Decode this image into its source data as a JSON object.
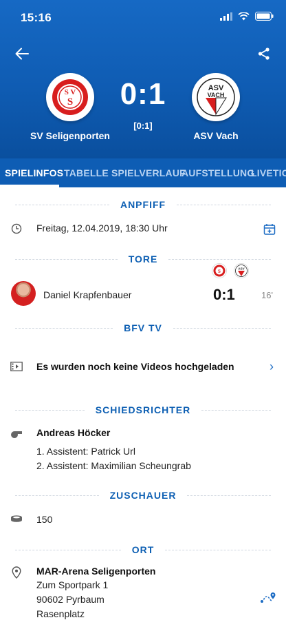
{
  "status_bar": {
    "time": "15:16"
  },
  "match": {
    "home_team": "SV Seligenporten",
    "away_team": "ASV Vach",
    "score": "0:1",
    "halftime": "[0:1]",
    "home_logo_text": "SVS",
    "away_logo_text": "ASV VACH"
  },
  "tabs": [
    {
      "label": "SPIELINFOS",
      "active": true
    },
    {
      "label": "TABELLE",
      "active": false
    },
    {
      "label": "SPIELVERLAUF",
      "active": false
    },
    {
      "label": "AUFSTELLUNG",
      "active": false
    },
    {
      "label": "LIVETICK",
      "active": false
    }
  ],
  "sections": {
    "anpfiff": {
      "title": "ANPFIFF",
      "datetime": "Freitag, 12.04.2019, 18:30 Uhr"
    },
    "tore": {
      "title": "TORE",
      "scorer": "Daniel Krapfenbauer",
      "score": "0:1",
      "minute": "16'"
    },
    "bfv_tv": {
      "title": "BFV TV",
      "message": "Es wurden noch keine Videos hochgeladen"
    },
    "schiedsrichter": {
      "title": "SCHIEDSRICHTER",
      "referee": "Andreas Höcker",
      "assistant1": "1. Assistent: Patrick Url",
      "assistant2": "2. Assistent: Maximilian Scheungrab"
    },
    "zuschauer": {
      "title": "ZUSCHAUER",
      "count": "150"
    },
    "ort": {
      "title": "ORT",
      "venue": "MAR-Arena Seligenporten",
      "street": "Zum Sportpark 1",
      "city": "90602 Pyrbaum",
      "surface": "Rasenplatz"
    }
  },
  "colors": {
    "header_blue": "#0f5cb3",
    "accent_blue": "#0d5fb3",
    "logo_red": "#d81e1e"
  }
}
